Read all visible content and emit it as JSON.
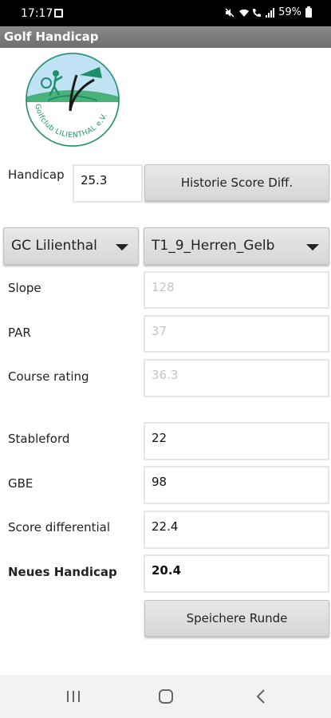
{
  "status_bar": {
    "time": "17:17",
    "battery_percent": "59%"
  },
  "app": {
    "title": "Golf Handicap"
  },
  "logo": {
    "text": "Golfclub LILIENTHAL e.V."
  },
  "handicap": {
    "label": "Handicap",
    "value": "25.3"
  },
  "history_button": {
    "label": "Historie Score Diff."
  },
  "club_select": {
    "selected": "GC Lilienthal"
  },
  "tee_select": {
    "selected": "T1_9_Herren_Gelb"
  },
  "course": {
    "slope": {
      "label": "Slope",
      "value": "128"
    },
    "par": {
      "label": "PAR",
      "value": "37"
    },
    "rating": {
      "label": "Course rating",
      "value": "36.3"
    }
  },
  "result": {
    "stableford": {
      "label": "Stableford",
      "value": "22"
    },
    "gbe": {
      "label": "GBE",
      "value": "98"
    },
    "score_diff": {
      "label": "Score differential",
      "value": "22.4"
    },
    "new_handicap": {
      "label": "Neues Handicap",
      "value": "20.4"
    }
  },
  "save_button": {
    "label": "Speichere Runde"
  },
  "colors": {
    "accent_green": "#1f8f6a",
    "sky_blue": "#bfe3f5",
    "grass_green": "#49b27a"
  }
}
